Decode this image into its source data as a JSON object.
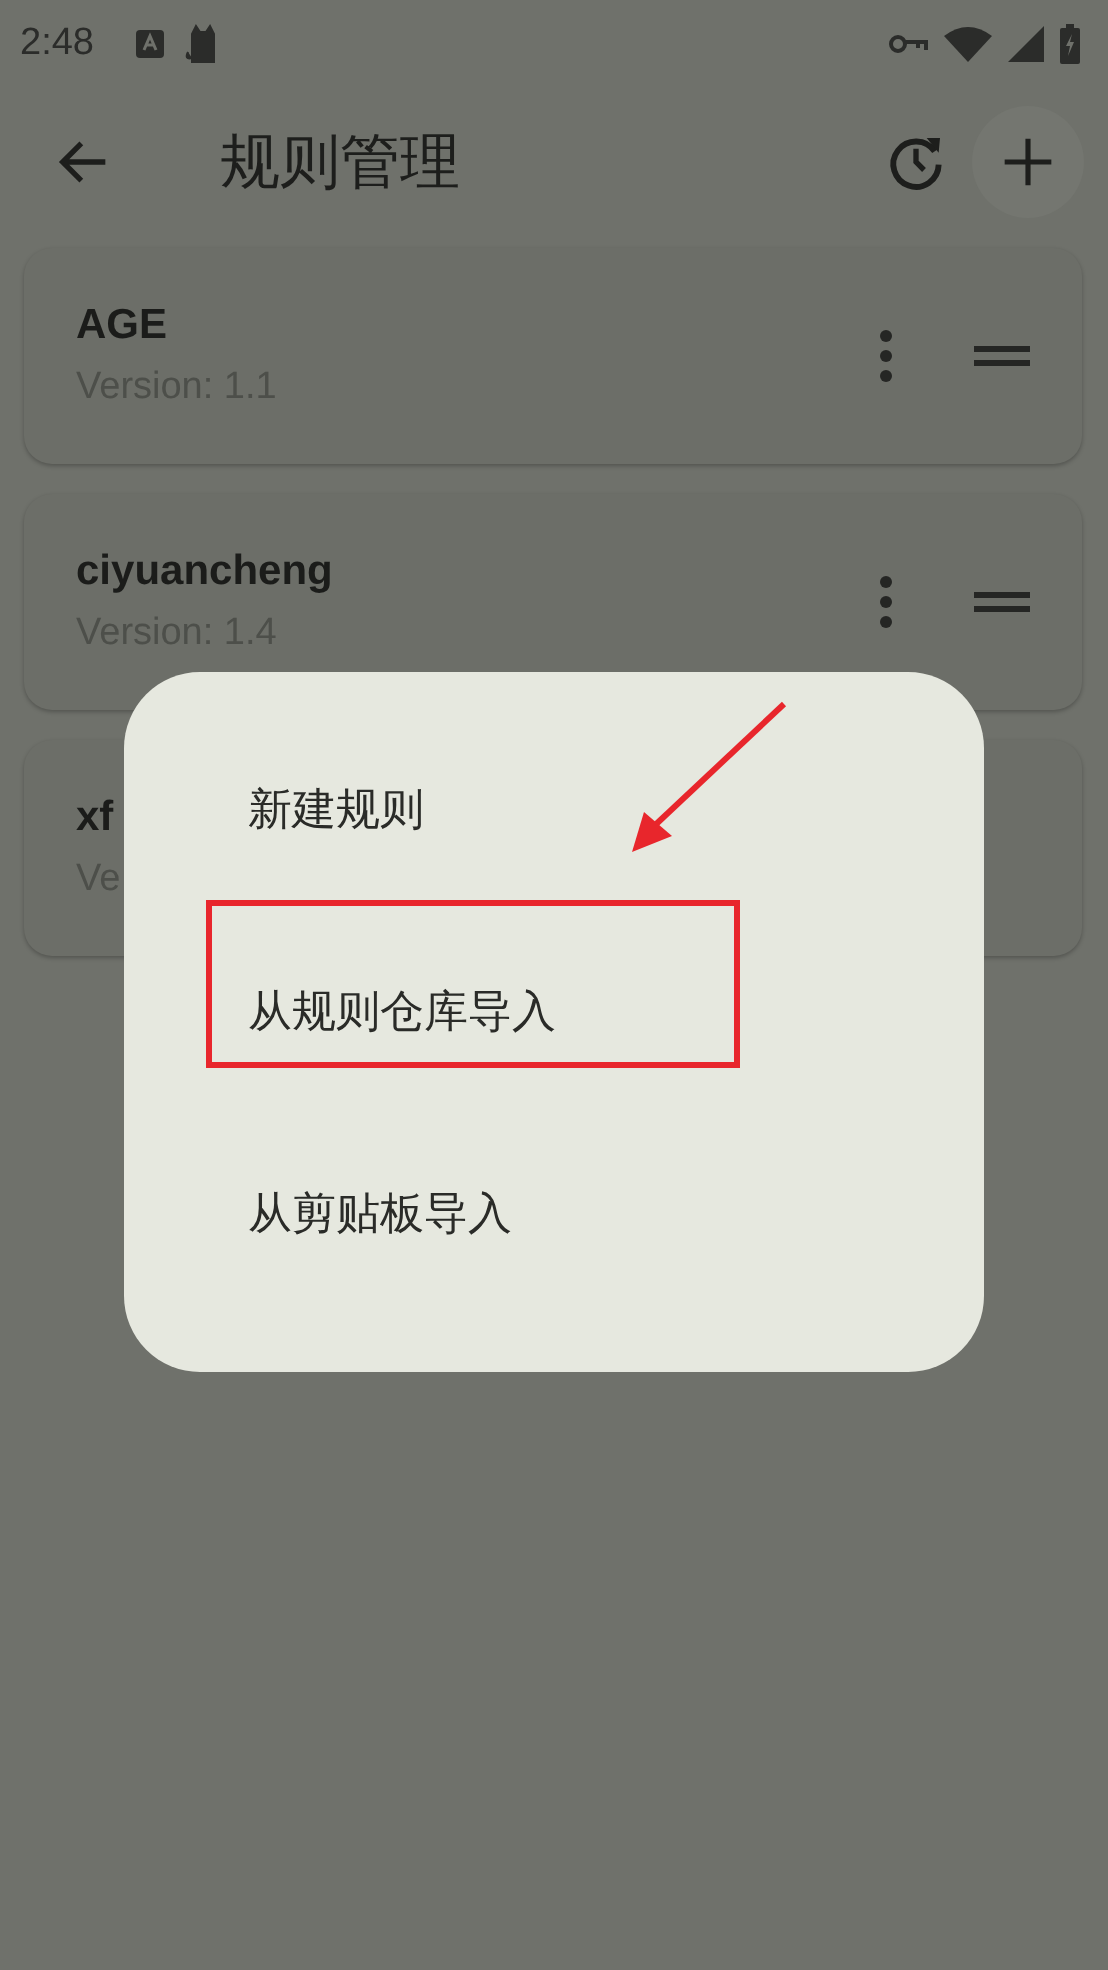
{
  "status_bar": {
    "time": "2:48"
  },
  "app_bar": {
    "title": "规则管理"
  },
  "rules": [
    {
      "name": "AGE",
      "version": "Version: 1.1",
      "kind": "full"
    },
    {
      "name": "ciyuancheng",
      "version": "Version: 1.4",
      "kind": "full"
    },
    {
      "name": "xf",
      "version": "Ve",
      "kind": "covered"
    }
  ],
  "dialog": {
    "items": [
      {
        "label": "新建规则",
        "highlighted": false
      },
      {
        "label": "从规则仓库导入",
        "highlighted": true
      },
      {
        "label": "从剪贴板导入",
        "highlighted": false
      }
    ]
  }
}
